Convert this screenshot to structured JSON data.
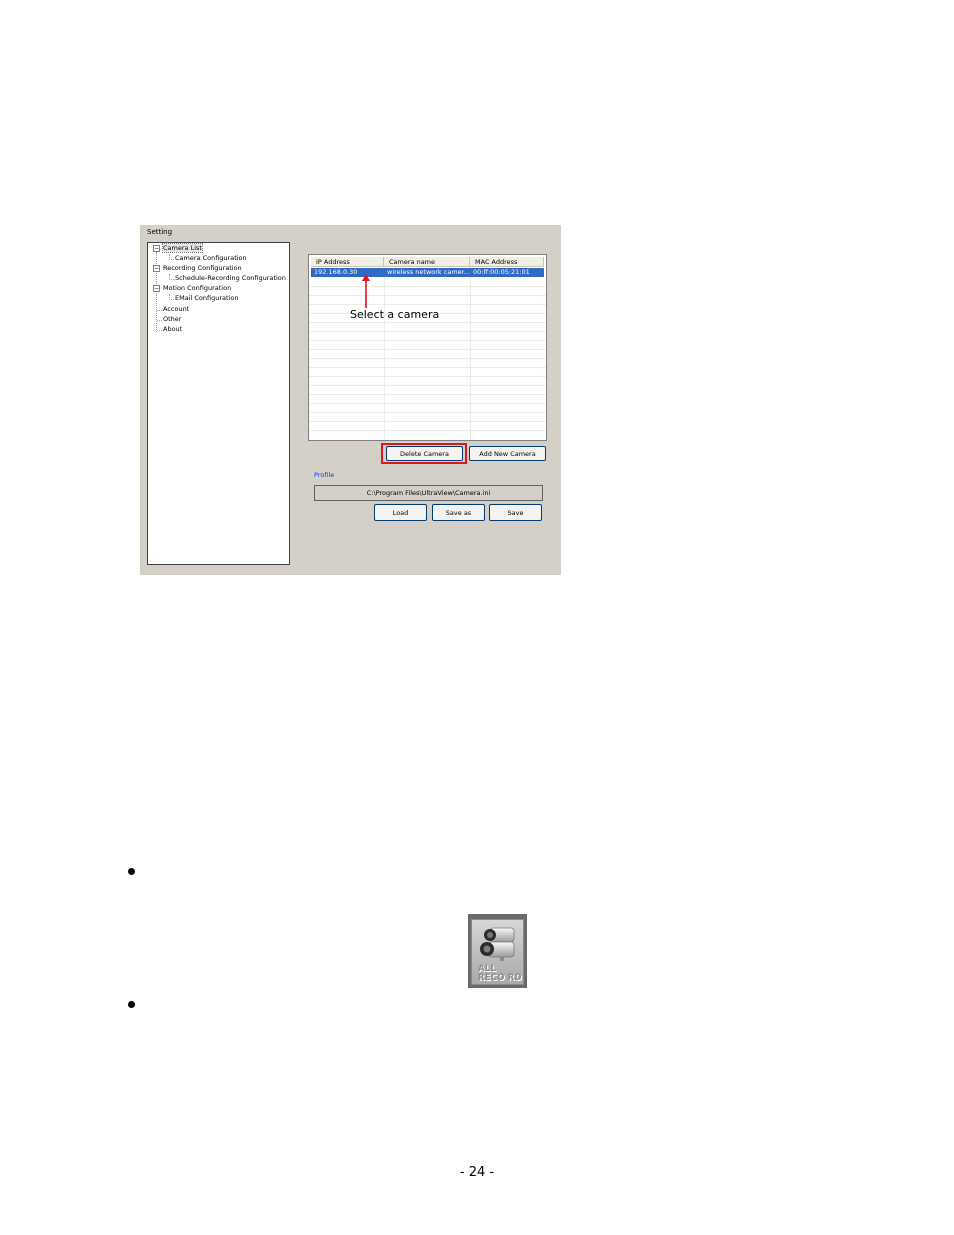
{
  "settings_window": {
    "title": "Setting",
    "tree": {
      "camera_list": "Camera List",
      "camera_configuration": "Camera Configuration",
      "recording_configuration": "Recording Configuration",
      "schedule_recording_configuration": "Schedule-Recording Configuration",
      "motion_configuration": "Motion Configuration",
      "email_configuration": "EMail Configuration",
      "account": "Account",
      "other": "Other",
      "about": "About",
      "expander_symbol": "−"
    },
    "camera_table": {
      "columns": [
        "IP Address",
        "Camera name",
        "MAC Address"
      ],
      "rows": [
        {
          "ip": "192.168.0.30",
          "name": "wireless network camer...",
          "mac": "00:ff:00:05:21:01"
        }
      ]
    },
    "buttons": {
      "delete_camera": "Delete Camera",
      "add_new_camera": "Add New Camera",
      "load": "Load",
      "save_as": "Save as",
      "save": "Save"
    },
    "profile": {
      "label": "Profile",
      "path": "C:\\Program Files\\UltraView\\Camera.ini"
    }
  },
  "annotation": {
    "text": "Select a camera",
    "arrow_color": "#e0161e"
  },
  "all_record_icon": {
    "line1": "ALL",
    "line2": "RECO RD"
  },
  "page_number": "- 24 -"
}
